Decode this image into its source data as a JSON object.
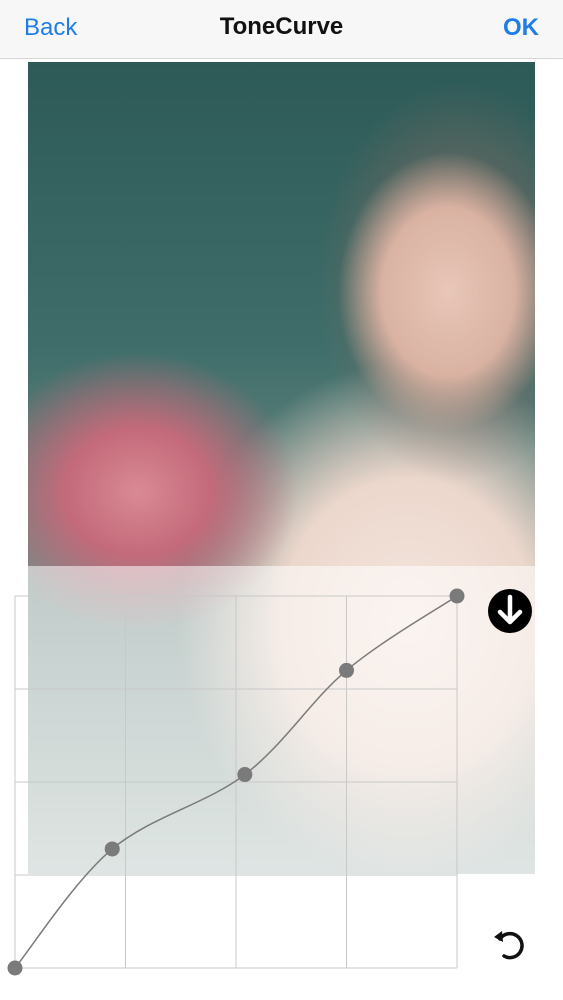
{
  "navbar": {
    "back_label": "Back",
    "title": "ToneCurve",
    "ok_label": "OK"
  },
  "tone_curve": {
    "grid_divisions": 4,
    "control_points": [
      {
        "input": 0.0,
        "output": 0.0
      },
      {
        "input": 0.22,
        "output": 0.32
      },
      {
        "input": 0.52,
        "output": 0.52
      },
      {
        "input": 0.75,
        "output": 0.8
      },
      {
        "input": 1.0,
        "output": 1.0
      }
    ],
    "colors": {
      "grid": "#c8c8c8",
      "curve": "#7a7a7a",
      "point": "#7a7a7a"
    }
  },
  "controls": {
    "collapse_icon": "arrow-down-circle-icon",
    "reset_icon": "undo-icon"
  }
}
